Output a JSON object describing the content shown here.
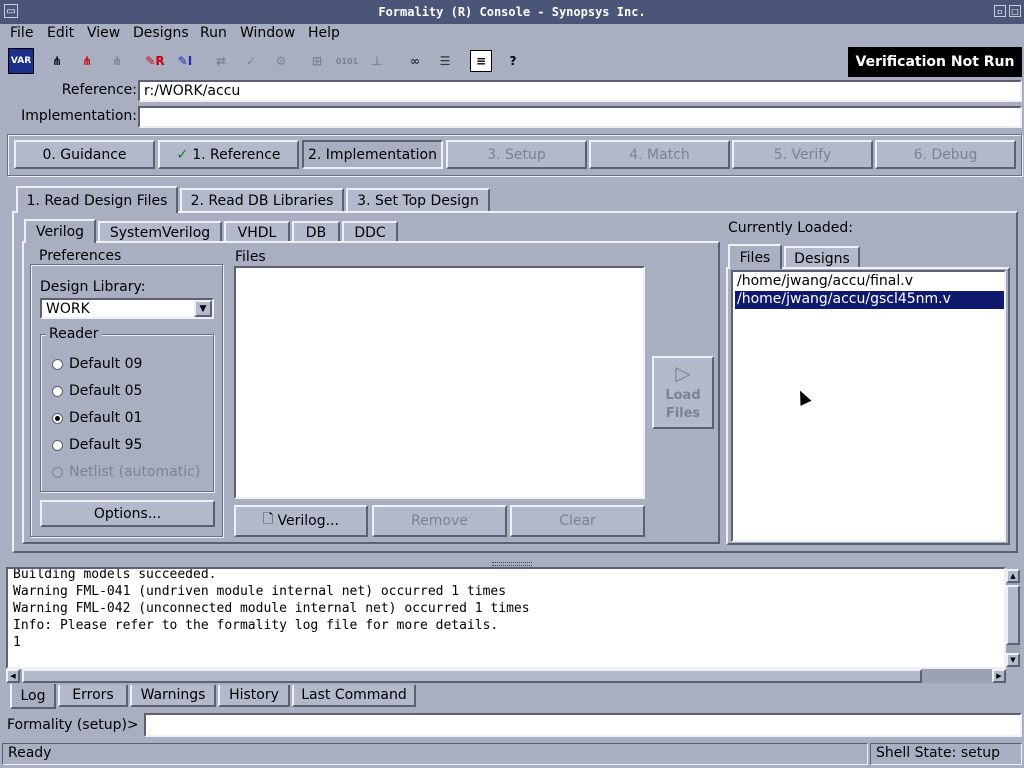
{
  "window": {
    "title": "Formality (R) Console - Synopsys Inc."
  },
  "menu": [
    "File",
    "Edit",
    "View",
    "Designs",
    "Run",
    "Window",
    "Help"
  ],
  "toolbar": {
    "status": "Verification Not Run"
  },
  "designs": {
    "reference_label": "Reference:",
    "reference_value": "r:/WORK/accu",
    "implementation_label": "Implementation:",
    "implementation_value": ""
  },
  "flow_steps": [
    {
      "label": "0. Guidance"
    },
    {
      "label": "1. Reference",
      "check": "✓"
    },
    {
      "label": "2. Implementation"
    },
    {
      "label": "3. Setup"
    },
    {
      "label": "4. Match"
    },
    {
      "label": "5. Verify"
    },
    {
      "label": "6. Debug"
    }
  ],
  "subtabs": [
    "1. Read Design Files",
    "2. Read DB Libraries",
    "3. Set Top Design"
  ],
  "format_tabs": [
    "Verilog",
    "SystemVerilog",
    "VHDL",
    "DB",
    "DDC"
  ],
  "preferences": {
    "title": "Preferences",
    "design_library_label": "Design Library:",
    "design_library_value": "WORK",
    "reader_title": "Reader",
    "readers": [
      "Default 09",
      "Default 05",
      "Default 01",
      "Default 95",
      "Netlist (automatic)"
    ],
    "options_label": "Options..."
  },
  "files": {
    "title": "Files",
    "add_label": "Verilog...",
    "remove_label": "Remove",
    "clear_label": "Clear",
    "load_line1": "Load",
    "load_line2": "Files"
  },
  "loaded": {
    "title": "Currently Loaded:",
    "tabs": [
      "Files",
      "Designs"
    ],
    "items": [
      "/home/jwang/accu/final.v",
      "/home/jwang/accu/gscl45nm.v"
    ]
  },
  "log": {
    "lines": [
      "Building models succeeded.",
      "Warning FML-041 (undriven module internal net) occurred 1 times",
      "Warning FML-042 (unconnected module internal net) occurred 1 times",
      "Info:  Please refer to the formality log file for more details.",
      "1"
    ],
    "tabs": [
      "Log",
      "Errors",
      "Warnings",
      "History",
      "Last Command"
    ]
  },
  "prompt": {
    "label": "Formality (setup)>",
    "value": ""
  },
  "status": {
    "left": "Ready",
    "right": "Shell State: setup"
  },
  "colors": {
    "titlebar": "#4a5578",
    "selection": "#0f1a6e",
    "background": "#a9afc1"
  }
}
